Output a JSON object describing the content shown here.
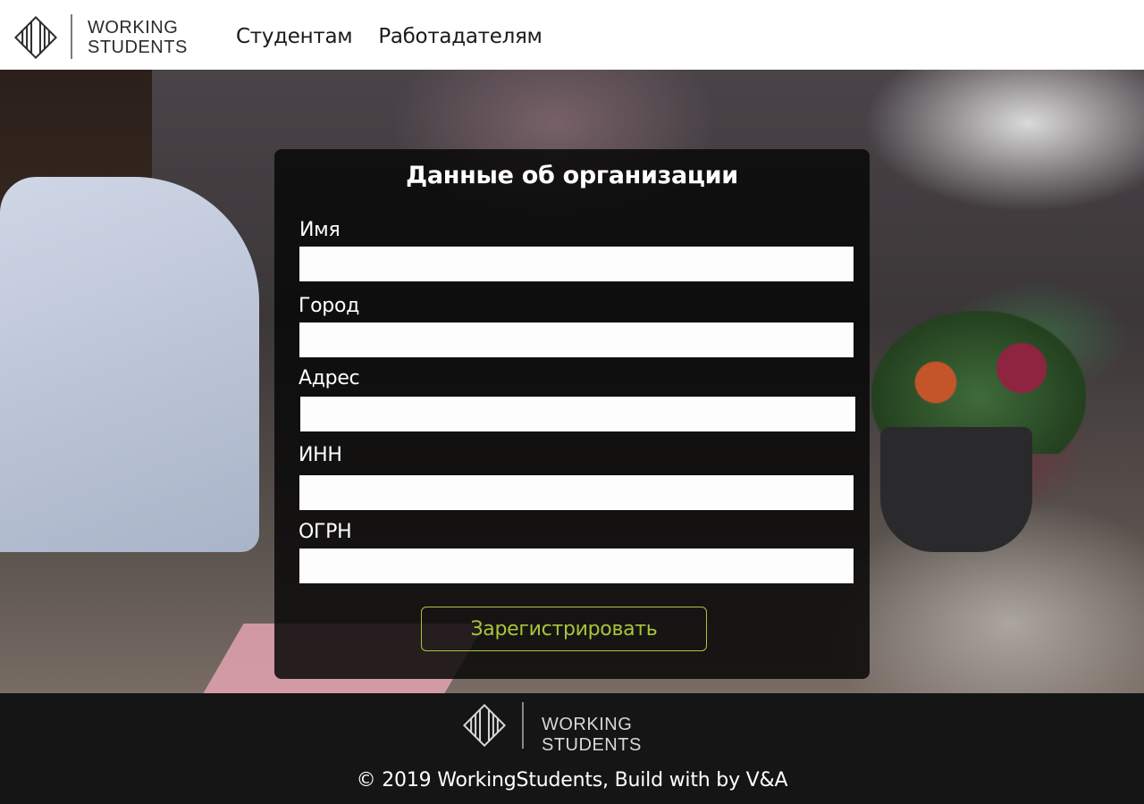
{
  "header": {
    "logo": {
      "line1": "WORKING",
      "line2": "STUDENTS",
      "icon": "logo-hatched-square-icon"
    },
    "nav": [
      {
        "label": "Студентам"
      },
      {
        "label": "Работадателям"
      }
    ]
  },
  "form": {
    "title": "Данные об организации",
    "fields": [
      {
        "label": "Имя",
        "value": "",
        "placeholder": ""
      },
      {
        "label": "Город",
        "value": "",
        "placeholder": ""
      },
      {
        "label": "Адрес",
        "value": "",
        "placeholder": ""
      },
      {
        "label": "ИНН",
        "value": "",
        "placeholder": ""
      },
      {
        "label": "ОГРН",
        "value": "",
        "placeholder": ""
      }
    ],
    "submit_label": "Зарегистрировать",
    "accent_color": "#a9c43a"
  },
  "footer": {
    "logo": {
      "line1": "WORKING",
      "line2": "STUDENTS",
      "icon": "logo-hatched-square-icon"
    },
    "copyright": "© 2019 WorkingStudents, Build with by V&A"
  }
}
